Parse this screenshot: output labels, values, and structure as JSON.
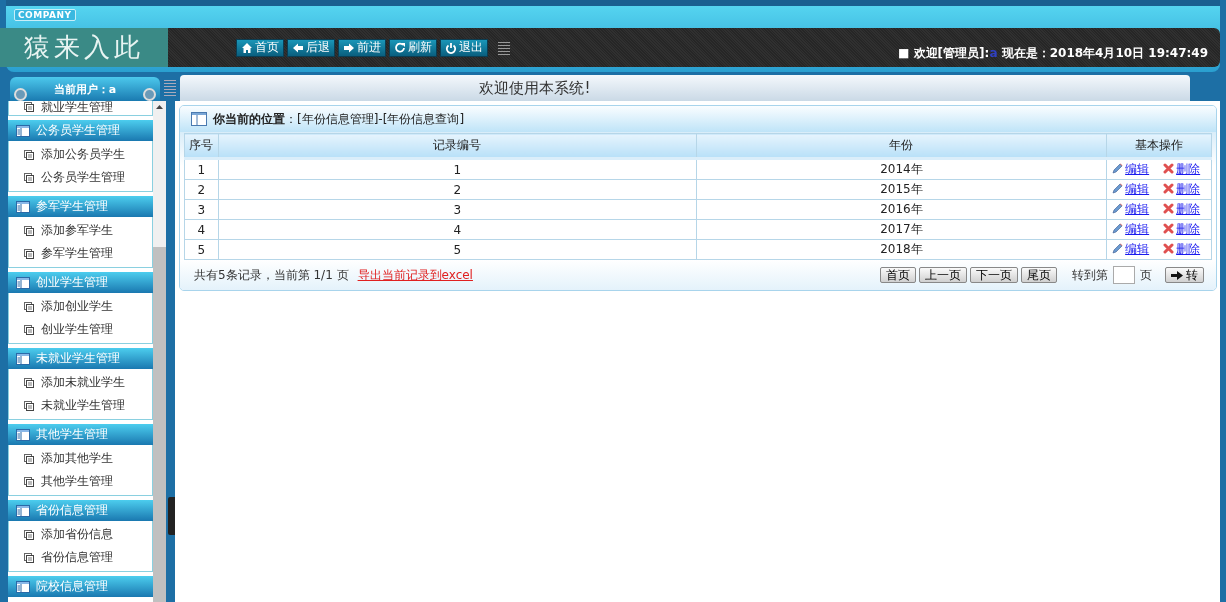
{
  "header": {
    "company_badge": "COMPANY",
    "logo": "猿来入此",
    "nav_buttons": [
      {
        "kind": "home",
        "label": "首页"
      },
      {
        "kind": "back",
        "label": "后退"
      },
      {
        "kind": "forward",
        "label": "前进"
      },
      {
        "kind": "refresh",
        "label": "刷新"
      },
      {
        "kind": "logout",
        "label": "退出"
      }
    ],
    "welcome": {
      "bullet": "■",
      "prefix": "欢迎[管理员]:",
      "user": "a",
      "time_label": "现在是：",
      "time": "2018年4月10日 19:47:49"
    }
  },
  "sidebar": {
    "current_user": "当前用户：a",
    "partial_item": "就业学生管理",
    "groups": [
      {
        "title": "公务员学生管理",
        "items": [
          "添加公务员学生",
          "公务员学生管理"
        ]
      },
      {
        "title": "参军学生管理",
        "items": [
          "添加参军学生",
          "参军学生管理"
        ]
      },
      {
        "title": "创业学生管理",
        "items": [
          "添加创业学生",
          "创业学生管理"
        ]
      },
      {
        "title": "未就业学生管理",
        "items": [
          "添加未就业学生",
          "未就业学生管理"
        ]
      },
      {
        "title": "其他学生管理",
        "items": [
          "添加其他学生",
          "其他学生管理"
        ]
      },
      {
        "title": "省份信息管理",
        "items": [
          "添加省份信息",
          "省份信息管理"
        ]
      },
      {
        "title": "院校信息管理"
      }
    ]
  },
  "welcome_banner": "欢迎使用本系统!",
  "breadcrumb": "**你当前的位置**：[年份信息管理]-[年份信息查询]",
  "table": {
    "columns": [
      "序号",
      "记录编号",
      "年份",
      "基本操作"
    ],
    "rows": [
      {
        "index": "1",
        "record_no": "1",
        "year": "2014年",
        "actions": [
          {
            "kind": "edit",
            "label": "编辑"
          },
          {
            "kind": "delete",
            "label": "删除"
          }
        ]
      },
      {
        "index": "2",
        "record_no": "2",
        "year": "2015年",
        "actions": [
          {
            "kind": "edit",
            "label": "编辑"
          },
          {
            "kind": "delete",
            "label": "删除"
          }
        ]
      },
      {
        "index": "3",
        "record_no": "3",
        "year": "2016年",
        "actions": [
          {
            "kind": "edit",
            "label": "编辑"
          },
          {
            "kind": "delete",
            "label": "删除"
          }
        ]
      },
      {
        "index": "4",
        "record_no": "4",
        "year": "2017年",
        "actions": [
          {
            "kind": "edit",
            "label": "编辑"
          },
          {
            "kind": "delete",
            "label": "删除"
          }
        ]
      },
      {
        "index": "5",
        "record_no": "5",
        "year": "2018年",
        "actions": [
          {
            "kind": "edit",
            "label": "编辑"
          },
          {
            "kind": "delete",
            "label": "删除"
          }
        ]
      }
    ]
  },
  "footer": {
    "summary": "共有5条记录，当前第 1/1 页",
    "export_link": "导出当前记录到excel",
    "pager_buttons": [
      "首页",
      "上一页",
      "下一页",
      "尾页"
    ],
    "goto_label": "转到第",
    "page_unit": "页",
    "go_button": "转"
  }
}
